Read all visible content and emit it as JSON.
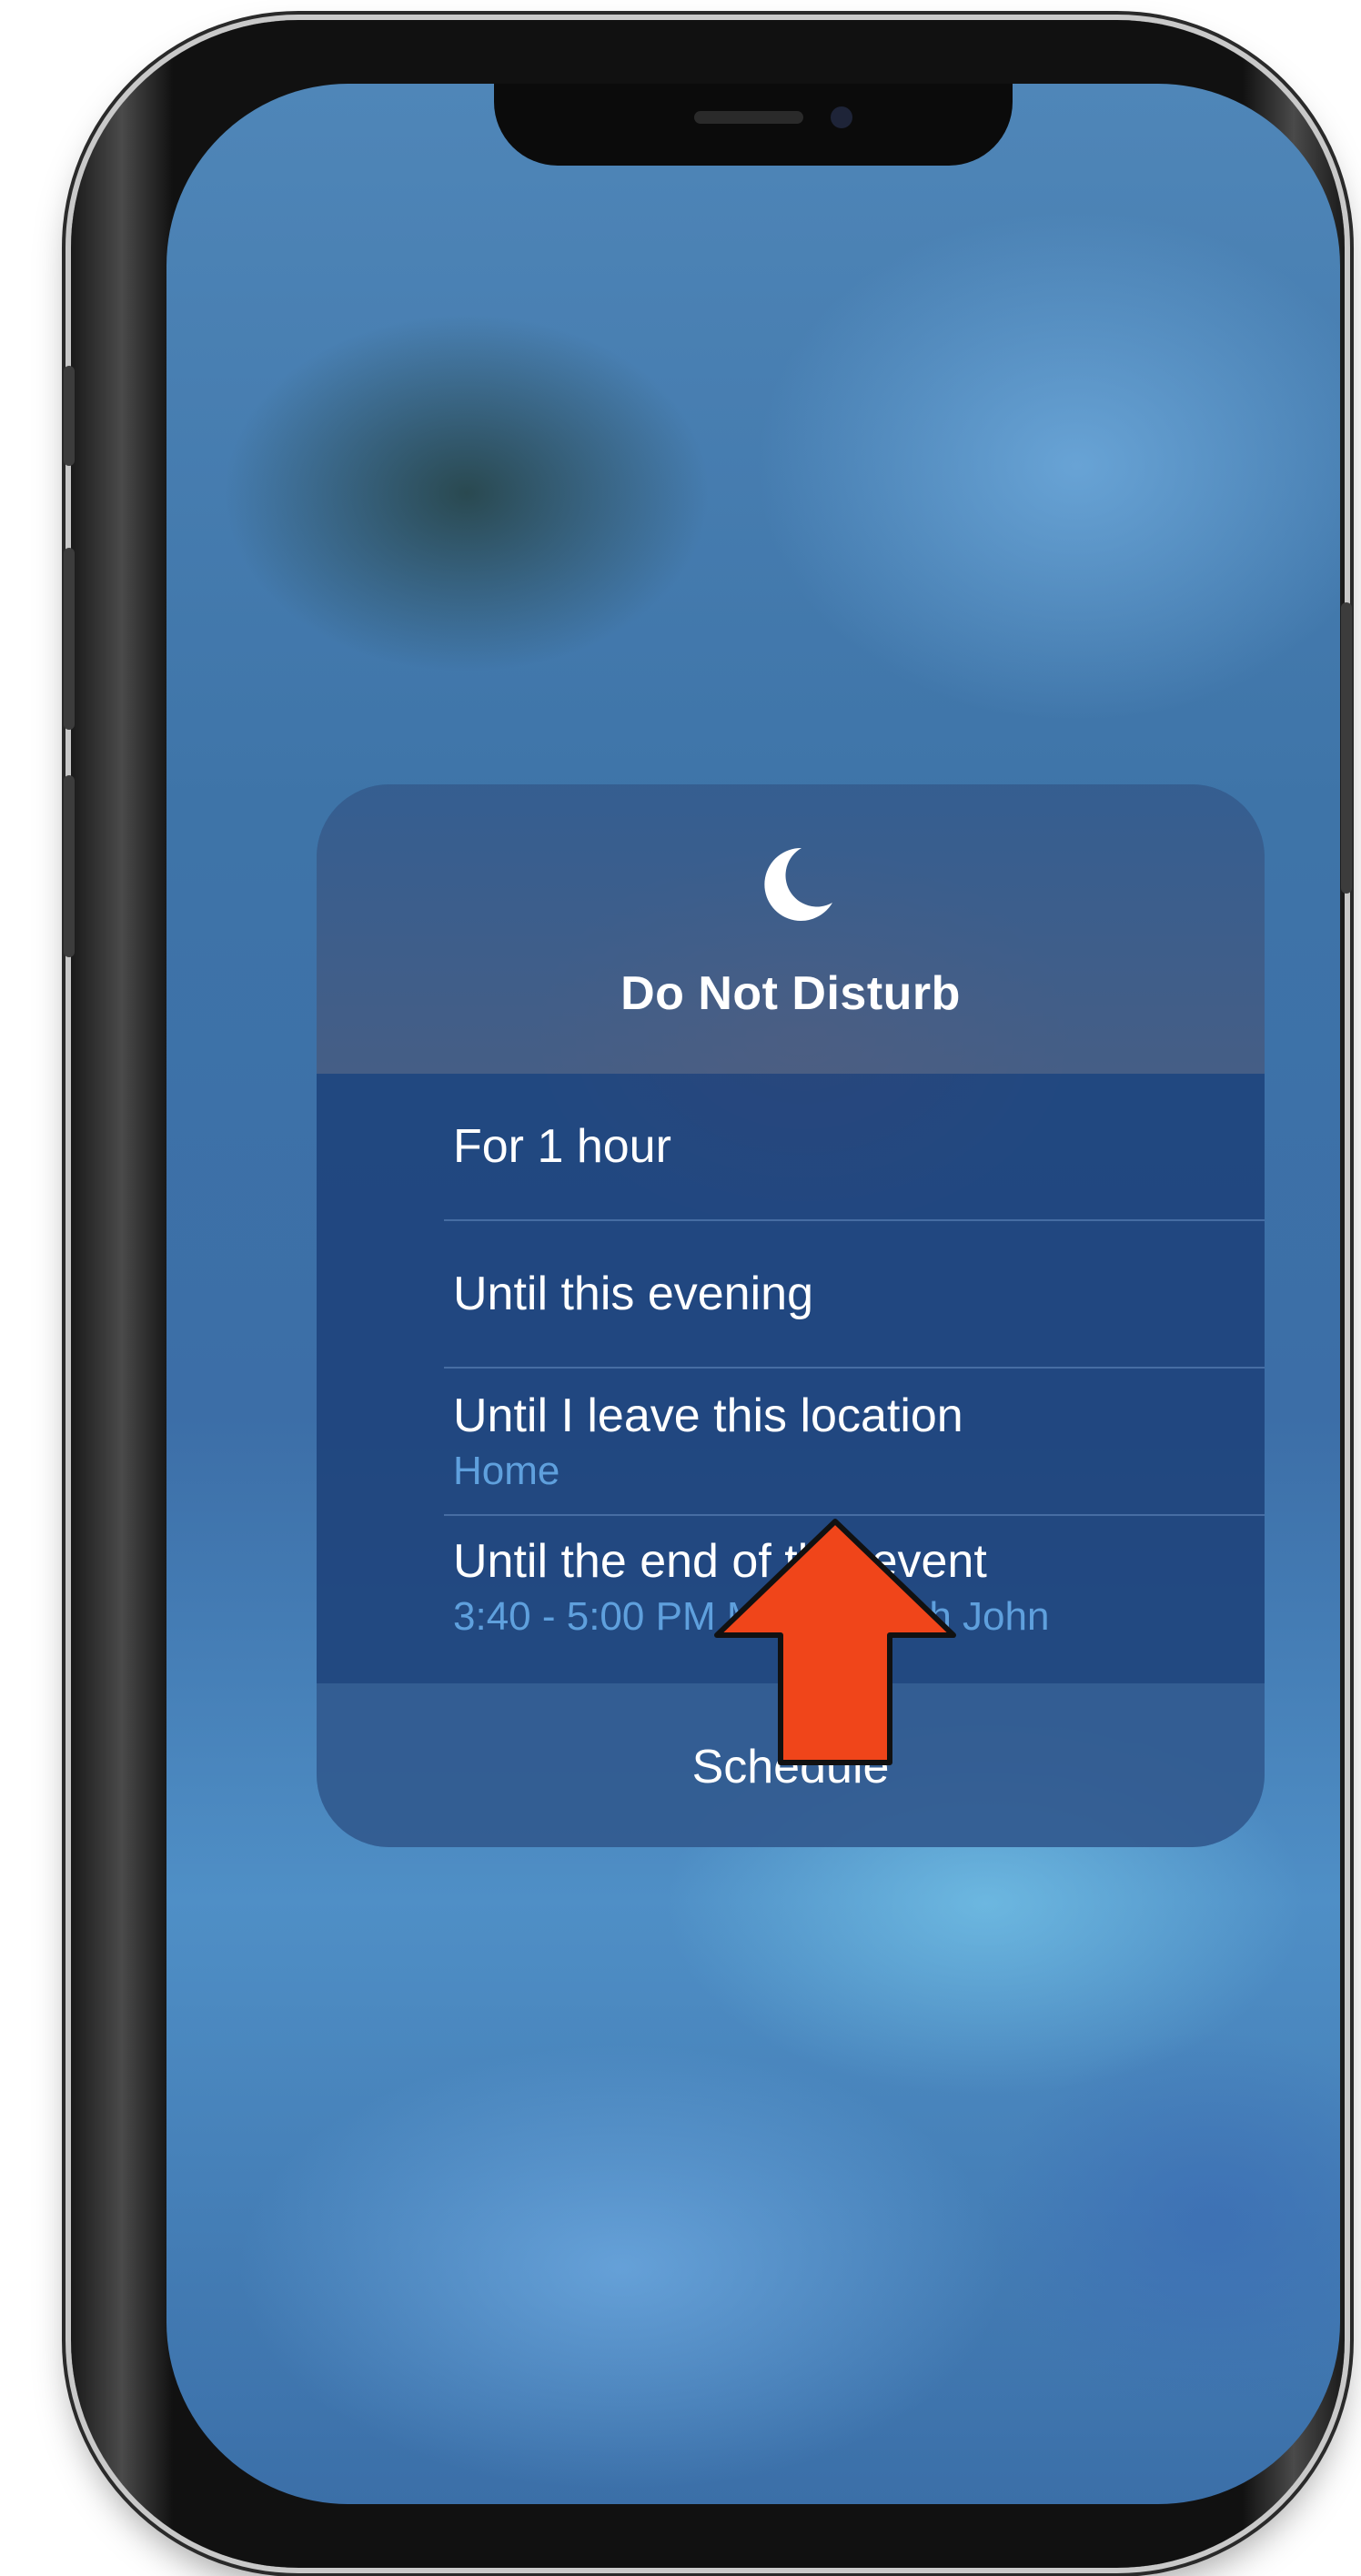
{
  "dnd": {
    "title": "Do Not Disturb",
    "icon": "moon-icon",
    "options": [
      {
        "label": "For 1 hour"
      },
      {
        "label": "Until this evening"
      },
      {
        "label": "Until I leave this location",
        "sub": "Home"
      },
      {
        "label": "Until the end of this event",
        "sub": "3:40 - 5:00 PM Meeting with John"
      }
    ],
    "schedule_label": "Schedule"
  },
  "annotation": {
    "icon": "up-arrow-icon",
    "color": "#f0451a"
  },
  "colors": {
    "accent_blue": "#5fa0dd",
    "text": "#ffffff"
  }
}
